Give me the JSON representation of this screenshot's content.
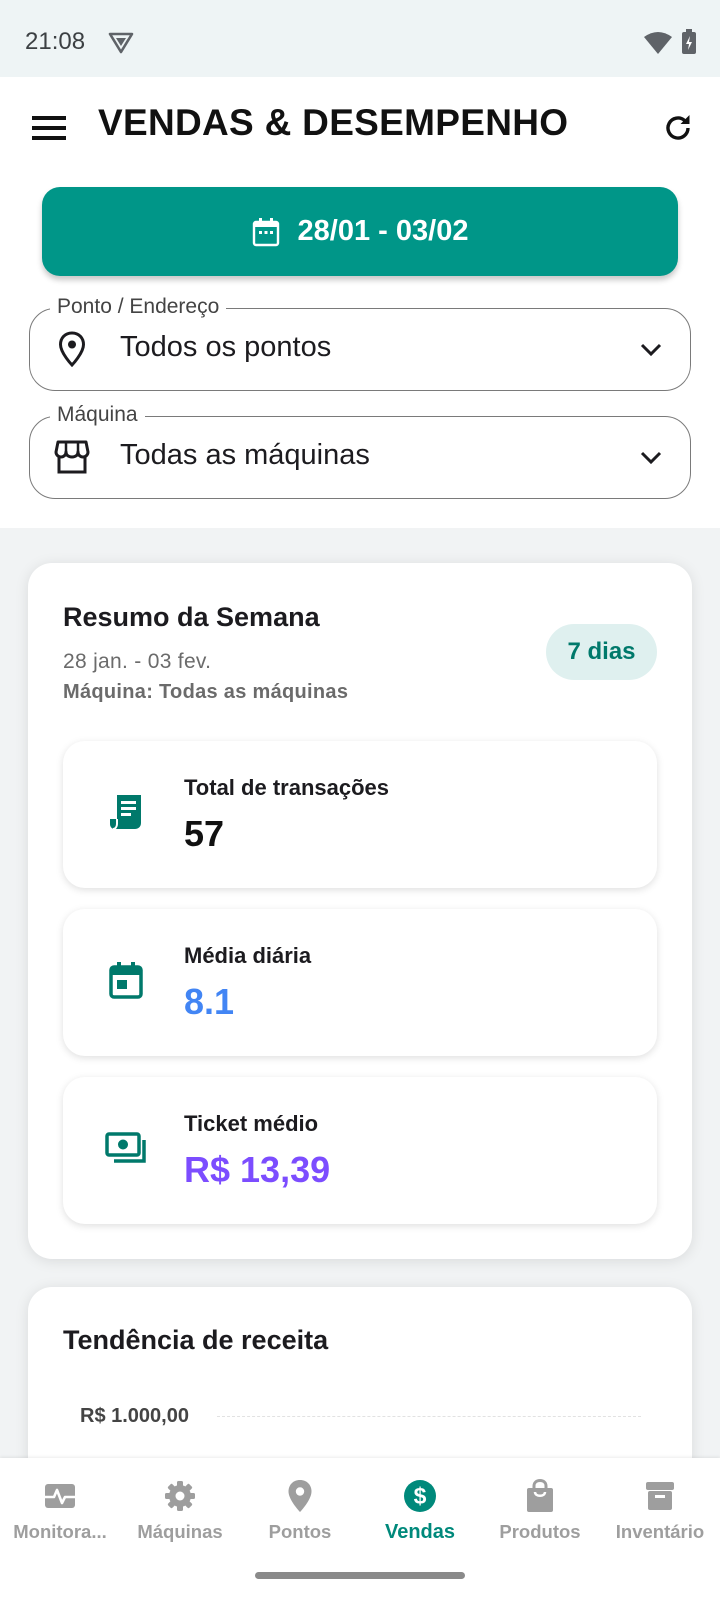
{
  "status_bar": {
    "time": "21:08"
  },
  "header": {
    "title": "VENDAS & DESEMPENHO"
  },
  "date_range": {
    "label": "28/01 - 03/02"
  },
  "filters": {
    "location": {
      "legend": "Ponto / Endereço",
      "value": "Todos os pontos"
    },
    "machine": {
      "legend": "Máquina",
      "value": "Todas as máquinas"
    }
  },
  "summary": {
    "title": "Resumo da Semana",
    "range": "28 jan. - 03 fev.",
    "machine": "Máquina: Todas as máquinas",
    "badge": "7 dias",
    "stats": [
      {
        "label": "Total de transações",
        "value": "57",
        "color": "#111111",
        "icon": "receipt-icon"
      },
      {
        "label": "Média diária",
        "value": "8.1",
        "color": "#4285f4",
        "icon": "calendar-icon"
      },
      {
        "label": "Ticket médio",
        "value": "R$ 13,39",
        "color": "#7c4dff",
        "icon": "cash-icon"
      }
    ]
  },
  "trend": {
    "title": "Tendência de receita",
    "y_tick_top": "R$ 1.000,00"
  },
  "bottom_nav": {
    "items": [
      {
        "label": "Monitora...",
        "icon": "pulse-icon"
      },
      {
        "label": "Máquinas",
        "icon": "gear-icon"
      },
      {
        "label": "Pontos",
        "icon": "pin-icon"
      },
      {
        "label": "Vendas",
        "icon": "dollar-icon"
      },
      {
        "label": "Produtos",
        "icon": "bag-icon"
      },
      {
        "label": "Inventário",
        "icon": "archive-icon"
      }
    ],
    "active_index": 3
  },
  "colors": {
    "accent": "#009688",
    "accent_text": "#00897b",
    "inactive": "#9e9e9e"
  }
}
